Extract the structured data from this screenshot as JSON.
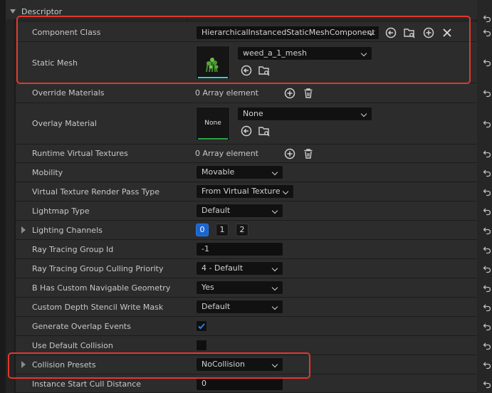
{
  "section": {
    "title": "Descriptor"
  },
  "rows": {
    "component_class": {
      "label": "Component Class",
      "value": "HierarchicalInstancedStaticMeshComponent"
    },
    "static_mesh": {
      "label": "Static Mesh",
      "value": "weed_a_1_mesh"
    },
    "override_materials": {
      "label": "Override Materials",
      "value": "0 Array element"
    },
    "overlay_material": {
      "label": "Overlay Material",
      "value": "None",
      "thumb_text": "None"
    },
    "runtime_virtual_textures": {
      "label": "Runtime Virtual Textures",
      "value": "0 Array element"
    },
    "mobility": {
      "label": "Mobility",
      "value": "Movable"
    },
    "vt_render_pass": {
      "label": "Virtual Texture Render Pass Type",
      "value": "From Virtual Texture"
    },
    "lightmap_type": {
      "label": "Lightmap Type",
      "value": "Default"
    },
    "lighting_channels": {
      "label": "Lighting Channels",
      "channels": [
        "0",
        "1",
        "2"
      ],
      "selected": "0"
    },
    "ray_tracing_group_id": {
      "label": "Ray Tracing Group Id",
      "value": "-1"
    },
    "ray_tracing_culling": {
      "label": "Ray Tracing Group Culling Priority",
      "value": "4 - Default"
    },
    "custom_nav_geometry": {
      "label": "B Has Custom Navigable Geometry",
      "value": "Yes"
    },
    "stencil_mask": {
      "label": "Custom Depth Stencil Write Mask",
      "value": "Default"
    },
    "overlap_events": {
      "label": "Generate Overlap Events",
      "checked": true
    },
    "default_collision": {
      "label": "Use Default Collision",
      "checked": false
    },
    "collision_presets": {
      "label": "Collision Presets",
      "value": "NoCollision"
    },
    "instance_cull": {
      "label": "Instance Start Cull Distance",
      "value": "0"
    }
  },
  "colors": {
    "highlight": "#e1382e",
    "accent_blue": "#1a64d0",
    "thumb_bar": "#2fd4c8"
  },
  "icons": [
    "reset-arrow-icon",
    "use-selected-icon",
    "browse-icon",
    "add-icon",
    "clear-icon",
    "delete-icon",
    "checkmark-icon",
    "chevron-down-icon"
  ]
}
